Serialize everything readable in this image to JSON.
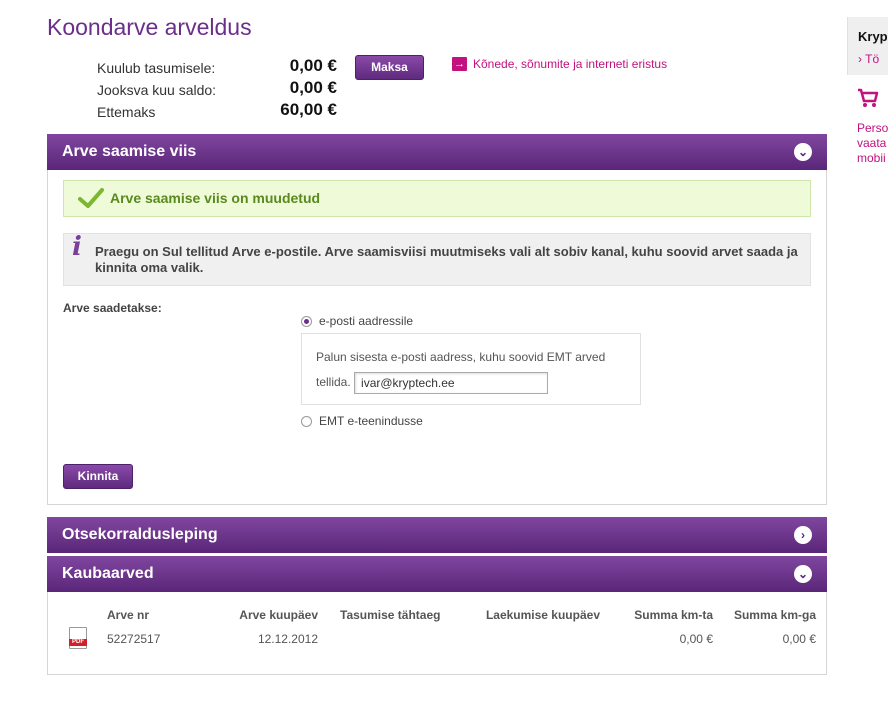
{
  "page": {
    "title": "Koondarve arveldus"
  },
  "summary": {
    "rows": [
      {
        "label": "Kuulub tasumisele:",
        "value": "0,00 €"
      },
      {
        "label": "Jooksva kuu saldo:",
        "value": "0,00 €"
      },
      {
        "label": "Ettemaks",
        "value": "60,00 €"
      }
    ],
    "pay_button": "Maksa",
    "calls_link": "Kõnede, sõnumite ja interneti eristus"
  },
  "billing_method": {
    "title": "Arve saamise viis",
    "success_message": "Arve saamise viis on muudetud",
    "info_text": "Praegu on Sul tellitud Arve e-postile. Arve saamisviisi muutmiseks vali alt sobiv kanal, kuhu soovid arvet saada ja kinnita oma valik.",
    "send_label": "Arve saadetakse:",
    "option_email": "e-posti aadressile",
    "email_prompt": "Palun sisesta e-posti aadress, kuhu soovid EMT arved tellida.",
    "email_value": "ivar@kryptech.ee",
    "option_portal": "EMT e-teenindusse",
    "selected": "email",
    "confirm_button": "Kinnita"
  },
  "direct_debit": {
    "title": "Otsekorraldusleping"
  },
  "goods_invoices": {
    "title": "Kaubaarved",
    "columns": [
      "Arve nr",
      "Arve kuupäev",
      "Tasumise tähtaeg",
      "Laekumise kuupäev",
      "Summa km-ta",
      "Summa km-ga"
    ],
    "rows": [
      {
        "icon_label": "PDF",
        "number": "52272517",
        "date": "12.12.2012",
        "due": "",
        "received": "",
        "sum_no_vat": "0,00 €",
        "sum_vat": "0,00 €"
      }
    ]
  },
  "sidebar": {
    "title": "Kryp",
    "link": "Tö",
    "text_lines": [
      "Perso",
      "vaata",
      "mobii"
    ]
  },
  "colors": {
    "brand": "#6b2f8a",
    "accent": "#c2127e",
    "success": "#5a8a1e"
  }
}
